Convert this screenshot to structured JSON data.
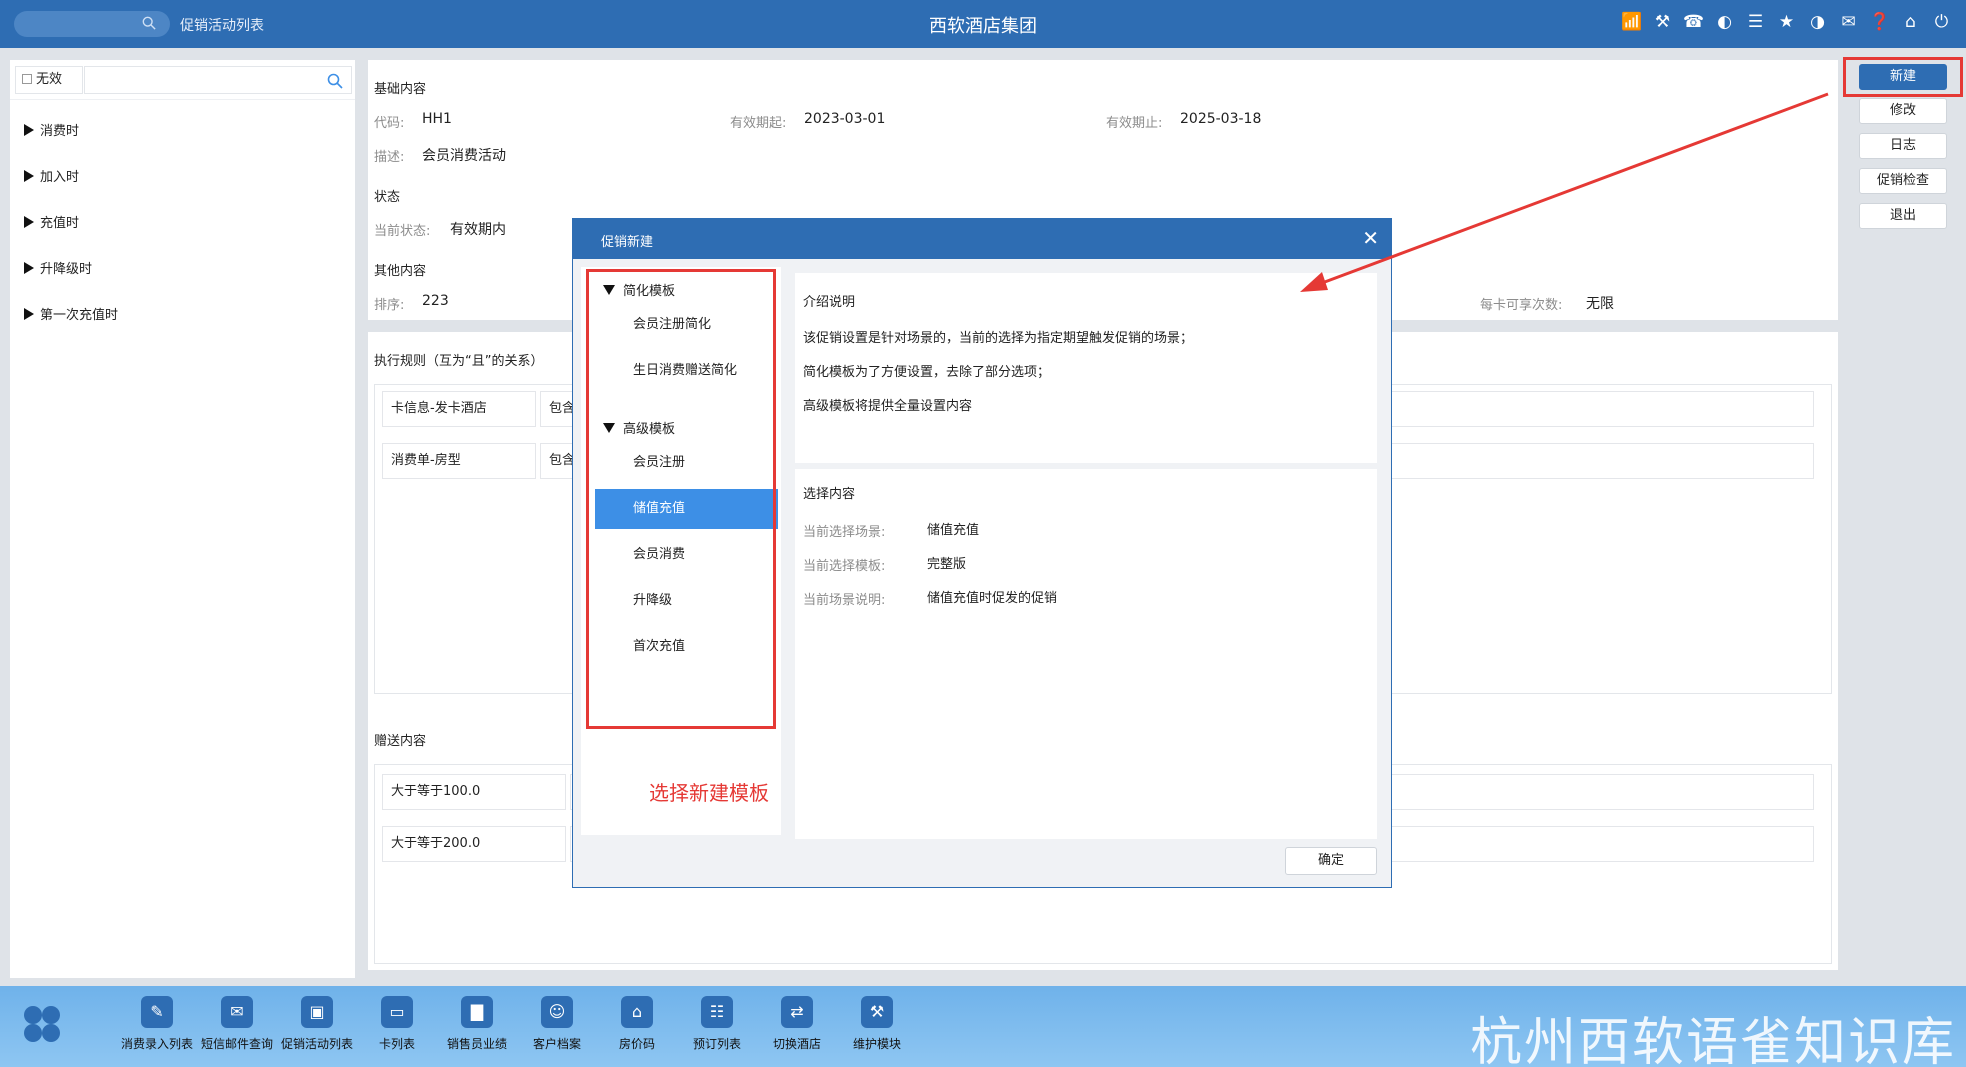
{
  "topbar": {
    "page_title": "促销活动列表",
    "app_title": "西软酒店集团",
    "icons": [
      "wifi-icon",
      "tools-icon",
      "phone-icon",
      "palette-icon",
      "menu-icon",
      "star-icon",
      "theme-icon",
      "mail-icon",
      "help-icon",
      "home-icon",
      "power-icon"
    ]
  },
  "left_panel": {
    "invalid_label": "无效",
    "search_value": "",
    "tree": [
      {
        "label": "消费时"
      },
      {
        "label": "加入时"
      },
      {
        "label": "充值时"
      },
      {
        "label": "升降级时"
      },
      {
        "label": "第一次充值时"
      }
    ]
  },
  "detail": {
    "basic_title": "基础内容",
    "code_label": "代码:",
    "code_value": "HH1",
    "valid_from_label": "有效期起:",
    "valid_from_value": "2023-03-01",
    "valid_to_label": "有效期止:",
    "valid_to_value": "2025-03-18",
    "desc_label": "描述:",
    "desc_value": "会员消费活动",
    "status_title": "状态",
    "current_status_label": "当前状态:",
    "current_status_value": "有效期内",
    "other_title": "其他内容",
    "sort_label": "排序:",
    "sort_value": "223",
    "per_card_label": "每卡可享次数:",
    "per_card_value": "无限",
    "rules_title": "执行规则（互为“且”的关系）",
    "rules": [
      {
        "field": "卡信息-发卡酒店",
        "op": "包含"
      },
      {
        "field": "消费单-房型",
        "op": "包含"
      }
    ],
    "gift_title": "赠送内容",
    "gifts": [
      {
        "condition": "大于等于100.0"
      },
      {
        "condition": "大于等于200.0"
      }
    ]
  },
  "right_buttons": {
    "new": "新建",
    "edit": "修改",
    "log": "日志",
    "promo_check": "促销检查",
    "exit": "退出"
  },
  "dialog": {
    "title": "促销新建",
    "groups": [
      {
        "label": "简化模板",
        "items": [
          "会员注册简化",
          "生日消费赠送简化"
        ]
      },
      {
        "label": "高级模板",
        "items": [
          "会员注册",
          "储值充值",
          "会员消费",
          "升降级",
          "首次充值"
        ]
      }
    ],
    "selected_item": "储值充值",
    "annotation": "选择新建模板",
    "intro_title": "介绍说明",
    "intro_lines": [
      "该促销设置是针对场景的，当前的选择为指定期望触发促销的场景；",
      "简化模板为了方便设置，去除了部分选项；",
      "高级模板将提供全量设置内容"
    ],
    "selection_title": "选择内容",
    "scene_label": "当前选择场景:",
    "scene_value": "储值充值",
    "template_label": "当前选择模板:",
    "template_value": "完整版",
    "scene_desc_label": "当前场景说明:",
    "scene_desc_value": "储值充值时促发的促销",
    "ok_label": "确定"
  },
  "dock": [
    {
      "label": "消费录入列表",
      "icon": "consumption-entry-icon"
    },
    {
      "label": "短信邮件查询",
      "icon": "sms-mail-icon"
    },
    {
      "label": "促销活动列表",
      "icon": "promotion-list-icon"
    },
    {
      "label": "卡列表",
      "icon": "card-list-icon"
    },
    {
      "label": "销售员业绩",
      "icon": "sales-performance-icon"
    },
    {
      "label": "客户档案",
      "icon": "customer-profile-icon"
    },
    {
      "label": "房价码",
      "icon": "rate-code-icon"
    },
    {
      "label": "预订列表",
      "icon": "reservation-list-icon"
    },
    {
      "label": "切换酒店",
      "icon": "switch-hotel-icon"
    },
    {
      "label": "维护模块",
      "icon": "maintenance-icon"
    }
  ],
  "watermark": "杭州西软语雀知识库",
  "colors": {
    "brand_blue": "#2e6db3",
    "selected_blue": "#3d8fe6",
    "highlight_red": "#e53935"
  }
}
